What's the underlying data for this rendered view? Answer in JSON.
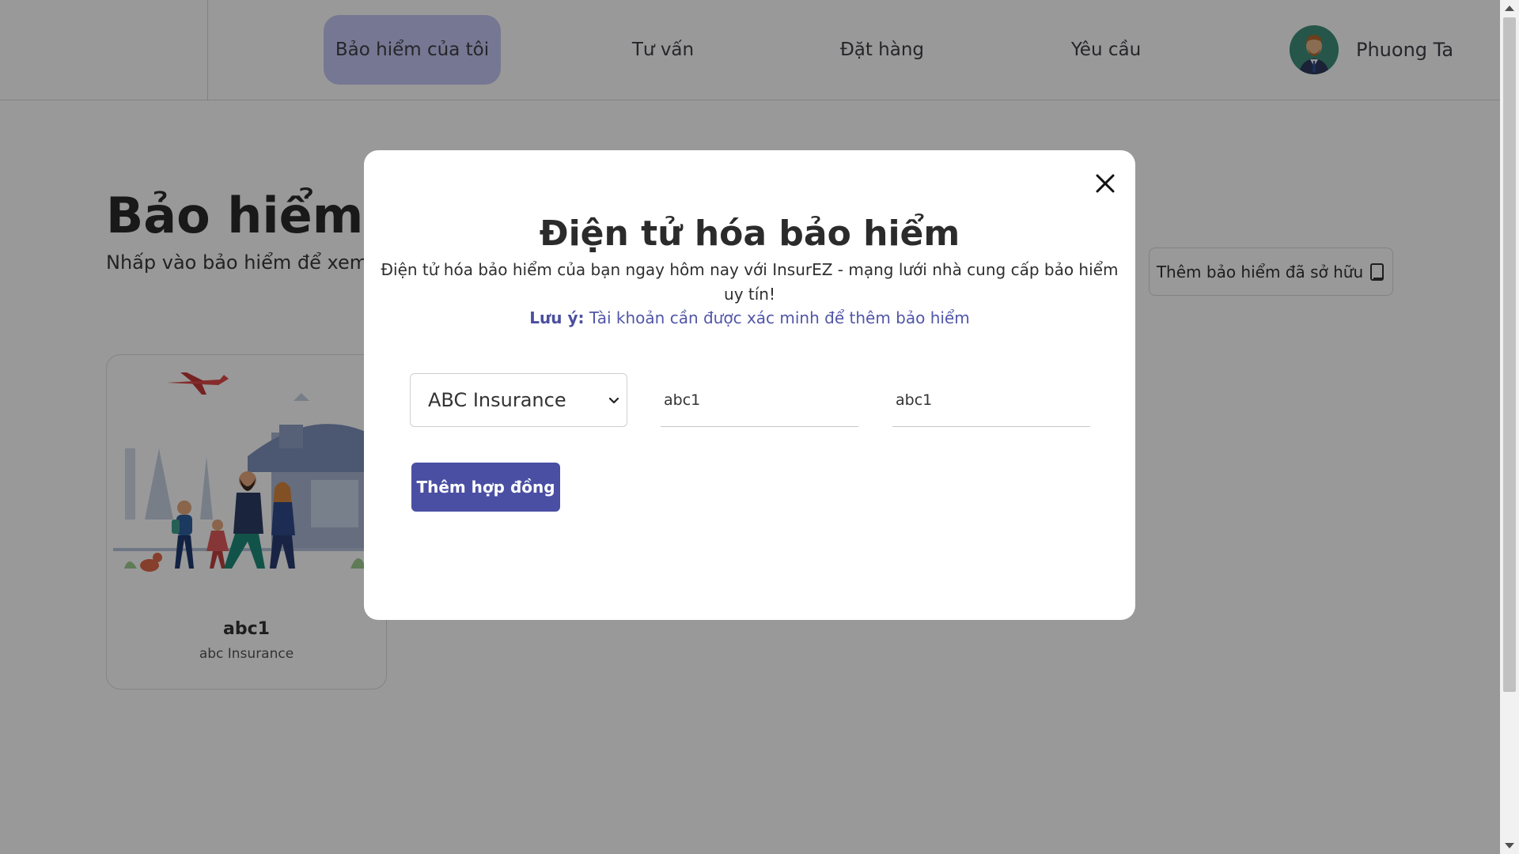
{
  "header": {
    "nav": [
      {
        "label": "Bảo hiểm của tôi",
        "active": true
      },
      {
        "label": "Tư vấn",
        "active": false
      },
      {
        "label": "Đặt hàng",
        "active": false
      },
      {
        "label": "Yêu cầu",
        "active": false
      }
    ],
    "user": {
      "name": "Phuong Ta",
      "avatar_icon": "user-avatar"
    }
  },
  "page": {
    "title": "Bảo hiểm của tôi",
    "subtitle": "Nhấp vào bảo hiểm để xem thông tin",
    "add_owned_button": "Thêm bảo hiểm đã sở hữu",
    "add_owned_icon": "document-icon",
    "cards": [
      {
        "name": "abc1",
        "company": "abc Insurance"
      }
    ]
  },
  "modal": {
    "title": "Điện tử hóa bảo hiểm",
    "description": "Điện tử hóa bảo hiểm của bạn ngay hôm nay với InsurEZ - mạng lưới nhà cung cấp bảo hiểm uy tín!",
    "note_label": "Lưu ý:",
    "note_text": "Tài khoản cần được xác minh để thêm bảo hiểm",
    "provider_select": {
      "value": "ABC Insurance"
    },
    "field_1": {
      "value": "abc1"
    },
    "field_2": {
      "value": "abc1"
    },
    "submit_label": "Thêm hợp đồng"
  },
  "colors": {
    "accent": "#4a4fa3",
    "nav_active_bg": "#c5c7f3",
    "overlay": "rgba(0,0,0,0.40)"
  }
}
